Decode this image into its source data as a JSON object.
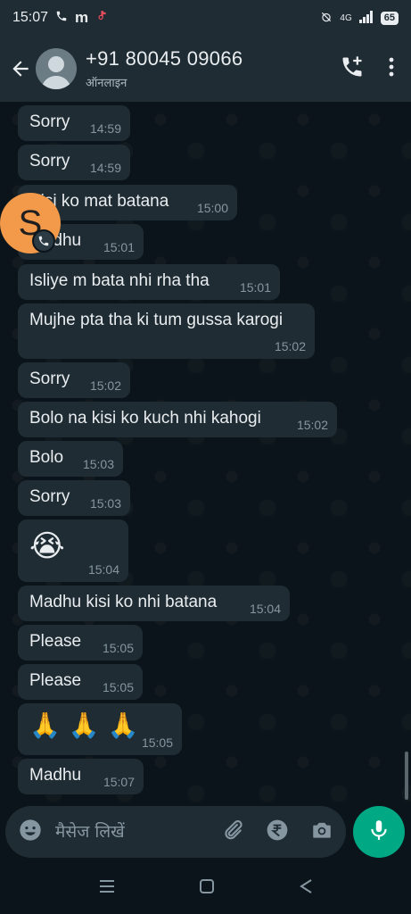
{
  "status_bar": {
    "time": "15:07",
    "network": "4G",
    "battery": "65"
  },
  "header": {
    "contact_name": "+91 80045 09066",
    "contact_status": "ऑनलाइन"
  },
  "floating_bubble": {
    "letter": "S"
  },
  "messages": [
    {
      "text": "Sorry",
      "time": "14:59"
    },
    {
      "text": "Sorry",
      "time": "14:59"
    },
    {
      "text": "Kisi ko mat batana",
      "time": "15:00"
    },
    {
      "text": "Madhu",
      "time": "15:01"
    },
    {
      "text": "Isliye m bata nhi rha tha",
      "time": "15:01"
    },
    {
      "text": "Mujhe pta tha ki tum gussa karogi",
      "time": "15:02"
    },
    {
      "text": "Sorry",
      "time": "15:02"
    },
    {
      "text": "Bolo na kisi ko kuch nhi kahogi",
      "time": "15:02"
    },
    {
      "text": "Bolo",
      "time": "15:03"
    },
    {
      "text": "Sorry",
      "time": "15:03"
    },
    {
      "text": "😭",
      "time": "15:04"
    },
    {
      "text": "Madhu kisi ko nhi batana",
      "time": "15:04"
    },
    {
      "text": "Please",
      "time": "15:05"
    },
    {
      "text": "Please",
      "time": "15:05"
    },
    {
      "text": "🙏 🙏 🙏",
      "time": "15:05"
    },
    {
      "text": "Madhu",
      "time": "15:07"
    }
  ],
  "composer": {
    "placeholder": "मैसेज लिखें"
  },
  "colors": {
    "accent": "#00a884",
    "bubble": "#1f2c34",
    "background": "#0b141a",
    "avatar_bubble": "#f2994a"
  }
}
